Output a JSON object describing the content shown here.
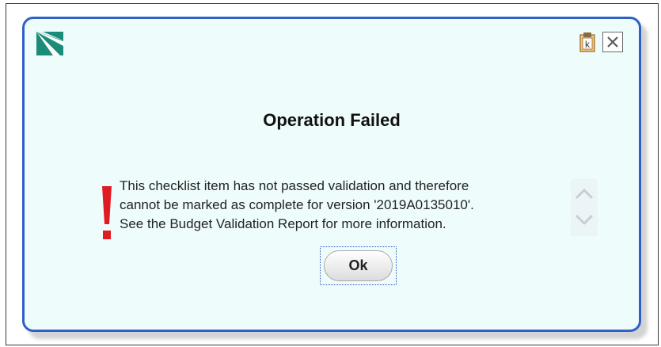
{
  "dialog": {
    "title": "Operation Failed",
    "message_lines": [
      "This checklist item has not passed validation and therefore",
      "cannot be marked as complete for version '2019A0135010'.",
      "See the Budget Validation Report for more information."
    ],
    "ok_label": "Ok",
    "help_icon_text": "k",
    "logo": "app-logo-icon",
    "help_icon": "clipboard-help-icon",
    "close_icon": "close-icon",
    "alert_icon": "error-exclamation-icon",
    "scroll_up_icon": "chevron-up-icon",
    "scroll_down_icon": "chevron-down-icon"
  },
  "colors": {
    "dialog_border": "#2f60c8",
    "dialog_background": "#eefdfc",
    "alert_red": "#e01b24",
    "logo_teal": "#1a8c78"
  }
}
